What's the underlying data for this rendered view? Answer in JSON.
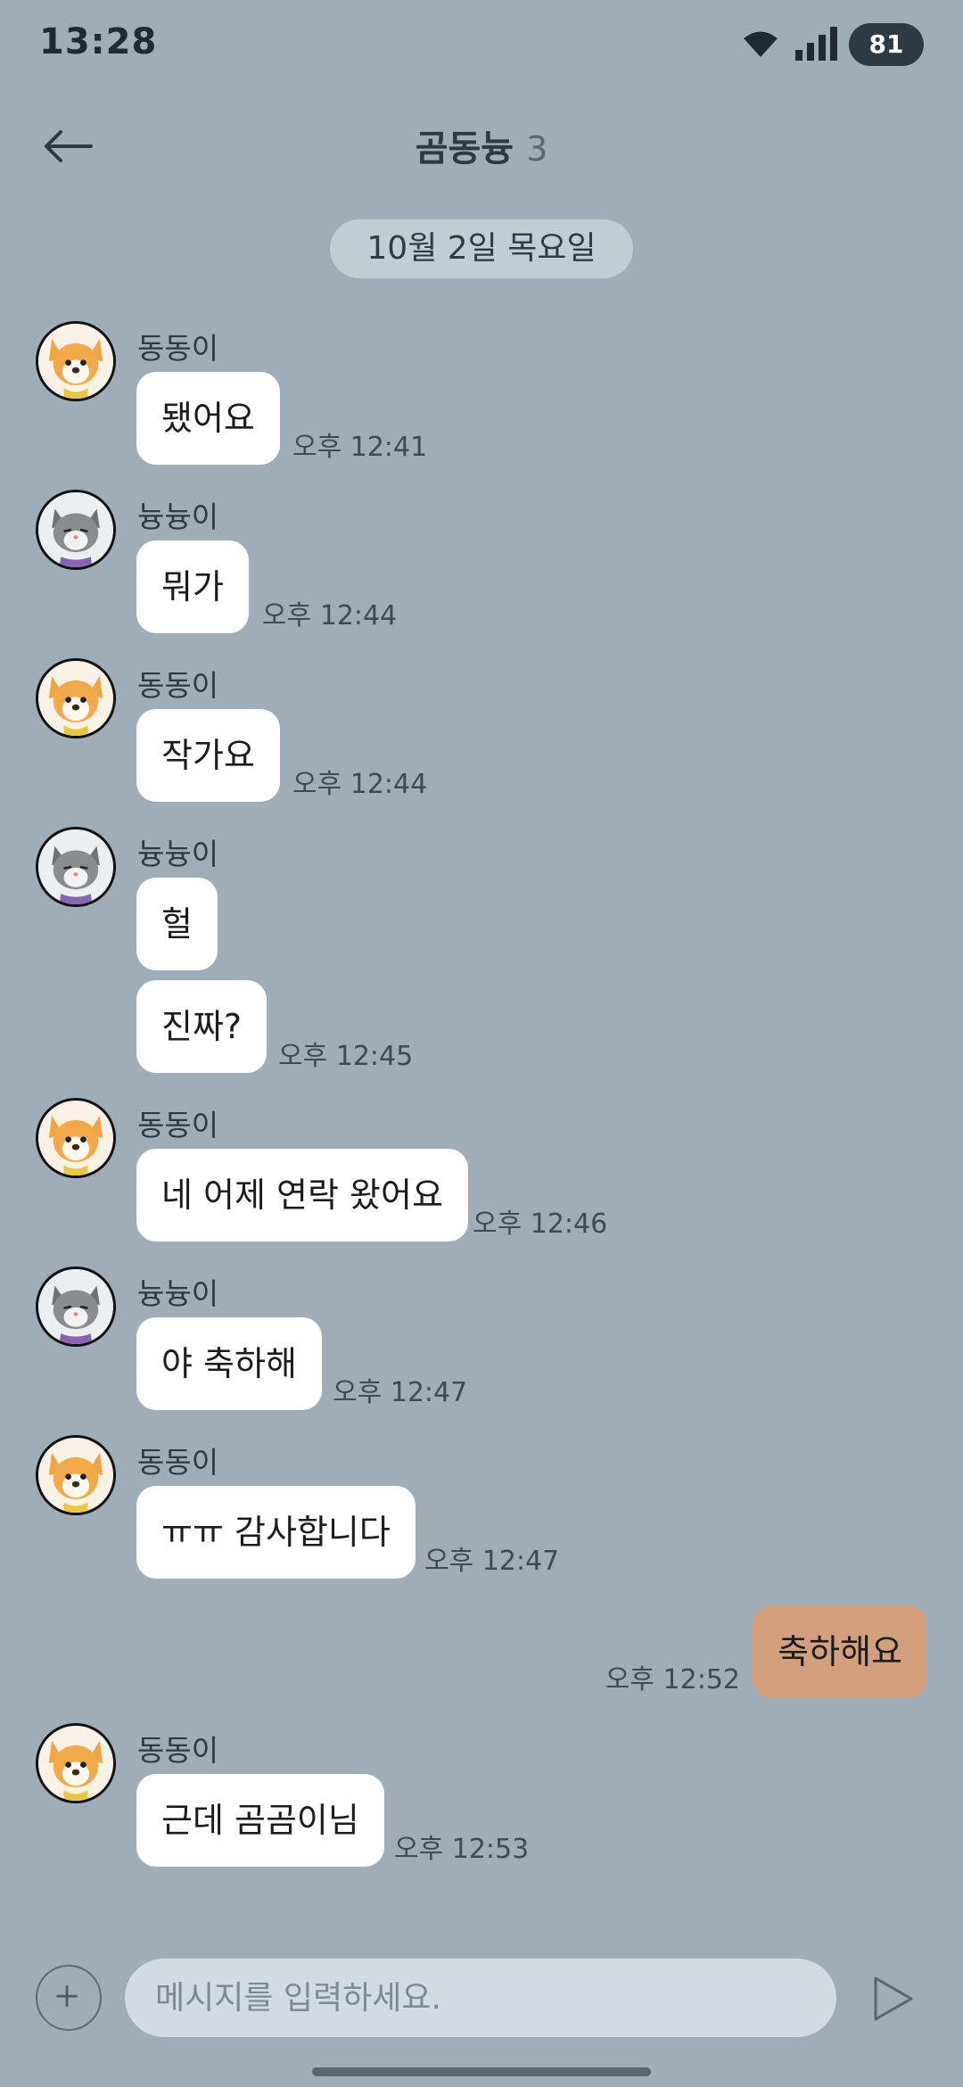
{
  "status_bar": {
    "time": "13:28",
    "battery": "81"
  },
  "header": {
    "title": "곰동늉",
    "member_count": "3"
  },
  "date_divider": "10월 2일 목요일",
  "messages": [
    {
      "sender": "동동이",
      "avatar": "dog",
      "text": "됐어요",
      "time": "오후 12:41"
    },
    {
      "sender": "늉늉이",
      "avatar": "cat",
      "text": "뭐가",
      "time": "오후 12:44"
    },
    {
      "sender": "동동이",
      "avatar": "dog",
      "text": "작가요",
      "time": "오후 12:44"
    },
    {
      "sender": "늉늉이",
      "avatar": "cat",
      "text": "헐",
      "text2": "진짜?",
      "time": "오후 12:45"
    },
    {
      "sender": "동동이",
      "avatar": "dog",
      "text": "네 어제 연락 왔어요",
      "time": "오후 12:46"
    },
    {
      "sender": "늉늉이",
      "avatar": "cat",
      "text": "야 축하해",
      "time": "오후 12:47"
    },
    {
      "sender": "동동이",
      "avatar": "dog",
      "text": "ㅠㅠ 감사합니다",
      "time": "오후 12:47"
    },
    {
      "sender": "me",
      "text": "축하해요",
      "time": "오후 12:52"
    },
    {
      "sender": "동동이",
      "avatar": "dog",
      "text": "근데 곰곰이님",
      "time": "오후 12:53"
    }
  ],
  "input": {
    "placeholder": "메시지를 입력하세요."
  },
  "icons": {
    "back": "arrow-left-icon",
    "wifi": "wifi-icon",
    "signal": "signal-icon",
    "plus": "plus-icon",
    "send": "send-icon"
  },
  "colors": {
    "background": "#9eadb7",
    "my_bubble": "#d2a07d",
    "other_bubble": "#ffffff"
  }
}
